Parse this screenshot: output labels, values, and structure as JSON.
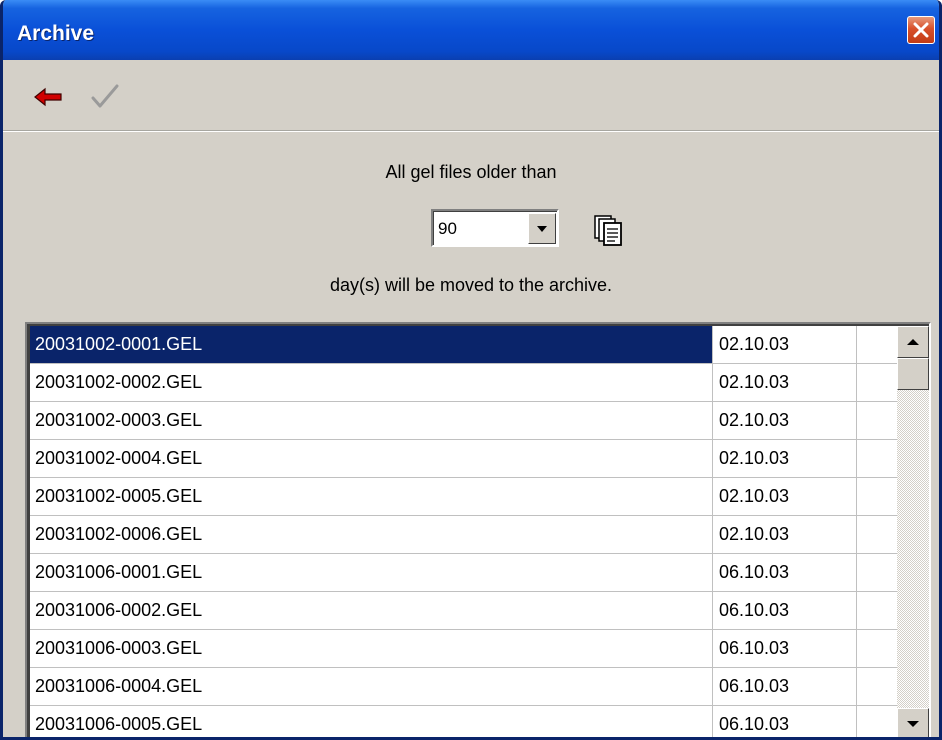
{
  "window": {
    "title": "Archive"
  },
  "toolbar": {
    "back_icon": "red-left-arrow",
    "ok_icon": "gray-checkmark"
  },
  "prompt": {
    "line1": "All gel files older than",
    "line2": "day(s) will be moved to the archive."
  },
  "days_select": {
    "value": "90"
  },
  "files": [
    {
      "name": "20031002-0001.GEL",
      "date": "02.10.03",
      "selected": true
    },
    {
      "name": "20031002-0002.GEL",
      "date": "02.10.03"
    },
    {
      "name": "20031002-0003.GEL",
      "date": "02.10.03"
    },
    {
      "name": "20031002-0004.GEL",
      "date": "02.10.03"
    },
    {
      "name": "20031002-0005.GEL",
      "date": "02.10.03"
    },
    {
      "name": "20031002-0006.GEL",
      "date": "02.10.03"
    },
    {
      "name": "20031006-0001.GEL",
      "date": "06.10.03"
    },
    {
      "name": "20031006-0002.GEL",
      "date": "06.10.03"
    },
    {
      "name": "20031006-0003.GEL",
      "date": "06.10.03"
    },
    {
      "name": "20031006-0004.GEL",
      "date": "06.10.03"
    },
    {
      "name": "20031006-0005.GEL",
      "date": "06.10.03"
    }
  ],
  "colors": {
    "titlebar": "#0a50d8",
    "selection": "#0a246a",
    "dialog_bg": "#d4d0c8"
  }
}
